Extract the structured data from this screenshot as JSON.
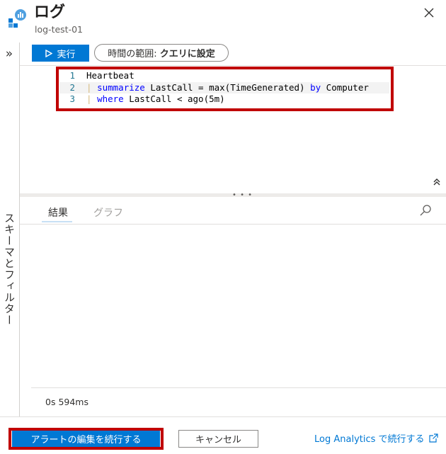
{
  "header": {
    "title": "ログ",
    "subtitle": "log-test-01"
  },
  "left_rail": {
    "expand_label": "»",
    "vertical_label": "スキーマとフィルター"
  },
  "toolbar": {
    "run_label": "実行",
    "time_range_prefix": "時間の範囲:",
    "time_range_value": "クエリに設定"
  },
  "editor": {
    "lines": [
      {
        "num": "1",
        "parts": [
          {
            "t": "Heartbeat",
            "c": "plain"
          }
        ]
      },
      {
        "num": "2",
        "parts": [
          {
            "t": "| ",
            "c": "guide"
          },
          {
            "t": "summarize",
            "c": "kw"
          },
          {
            "t": " LastCall = max(TimeGenerated) ",
            "c": "plain"
          },
          {
            "t": "by",
            "c": "kw"
          },
          {
            "t": " Computer",
            "c": "plain"
          }
        ]
      },
      {
        "num": "3",
        "parts": [
          {
            "t": "| ",
            "c": "guide"
          },
          {
            "t": "where",
            "c": "kw"
          },
          {
            "t": " LastCall < ago(5m)",
            "c": "plain"
          }
        ]
      }
    ],
    "collapse_icon": "double-chevron-up-icon"
  },
  "results": {
    "tabs": [
      {
        "label": "結果",
        "active": true
      },
      {
        "label": "グラフ",
        "active": false
      }
    ],
    "elapsed": "0s 594ms"
  },
  "footer": {
    "continue_label": "アラートの編集を続行する",
    "cancel_label": "キャンセル",
    "la_link_label": "Log Analytics で続行する"
  },
  "colors": {
    "accent": "#0078d4",
    "highlight": "#c00000"
  }
}
